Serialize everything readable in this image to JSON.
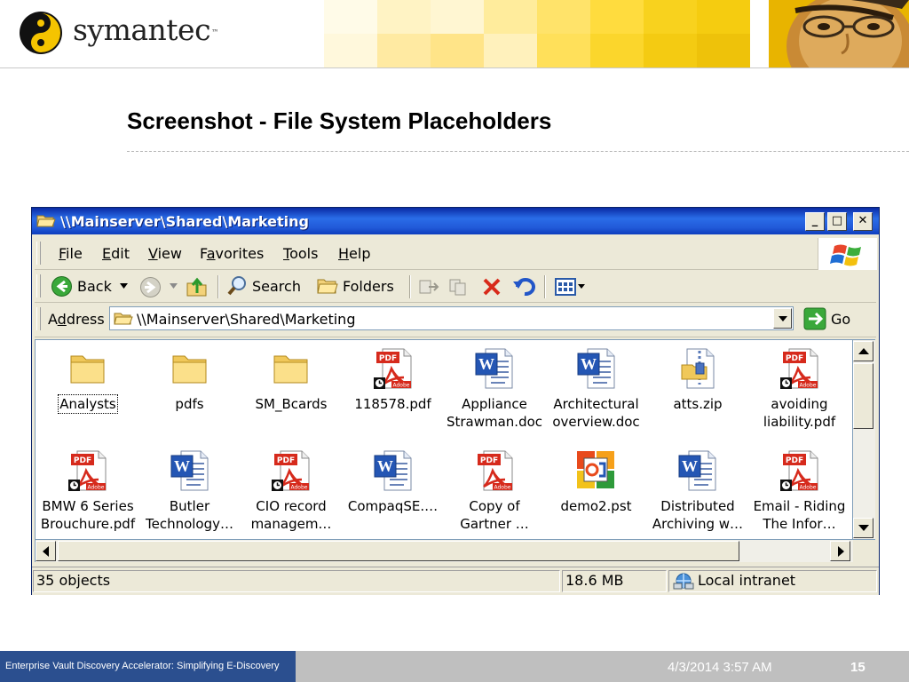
{
  "slide": {
    "brand": "symantec",
    "brand_mark": "™",
    "title": "Screenshot - File System Placeholders",
    "footer_text": "Enterprise Vault Discovery Accelerator: Simplifying E-Discovery",
    "footer_date": "4/3/2014 3:57 AM",
    "page_number": "15",
    "colors": {
      "brand_yellow": "#f5c400",
      "footer_blue": "#2b4f8f",
      "footer_gray": "#bfbfbf"
    }
  },
  "window": {
    "title": "\\\\Mainserver\\Shared\\Marketing",
    "controls": {
      "minimize": "_",
      "maximize": "□",
      "close": "✕"
    },
    "menu": [
      {
        "key": "F",
        "rest": "ile"
      },
      {
        "key": "E",
        "rest": "dit"
      },
      {
        "key": "V",
        "rest": "iew"
      },
      {
        "pre": "F",
        "key": "a",
        "rest": "vorites"
      },
      {
        "key": "T",
        "rest": "ools"
      },
      {
        "key": "H",
        "rest": "elp"
      }
    ],
    "toolbar": {
      "back": "Back",
      "search": "Search",
      "folders": "Folders"
    },
    "address": {
      "label_pre": "A",
      "label_key": "d",
      "label_rest": "dress",
      "value": "\\\\Mainserver\\Shared\\Marketing",
      "go": "Go"
    },
    "files": [
      {
        "name": "Analysts",
        "type": "folder",
        "selected": true
      },
      {
        "name": "pdfs",
        "type": "folder"
      },
      {
        "name": "SM_Bcards",
        "type": "folder"
      },
      {
        "name": "118578.pdf",
        "type": "pdf-placeholder"
      },
      {
        "name": "Appliance\nStrawman.doc",
        "type": "word"
      },
      {
        "name": "Architectural\noverview.doc",
        "type": "word"
      },
      {
        "name": "atts.zip",
        "type": "zip"
      },
      {
        "name": "avoiding\nliability.pdf",
        "type": "pdf-placeholder"
      },
      {
        "name": "BMW 6 Series\nBrouchure.pdf",
        "type": "pdf-placeholder"
      },
      {
        "name": "Butler\nTechnology…",
        "type": "word"
      },
      {
        "name": "CIO record\nmanagem…",
        "type": "pdf-placeholder"
      },
      {
        "name": "CompaqSE.…",
        "type": "word"
      },
      {
        "name": "Copy of\nGartner …",
        "type": "pdf"
      },
      {
        "name": "demo2.pst",
        "type": "outlook"
      },
      {
        "name": "Distributed\nArchiving w…",
        "type": "word"
      },
      {
        "name": "Email - Riding\nThe Infor…",
        "type": "pdf-placeholder"
      }
    ],
    "status": {
      "objects": "35 objects",
      "size": "18.6 MB",
      "zone": "Local intranet"
    },
    "icon_names": {
      "pdf_badge": "PDF",
      "pdf_brand": "Adobe"
    }
  }
}
